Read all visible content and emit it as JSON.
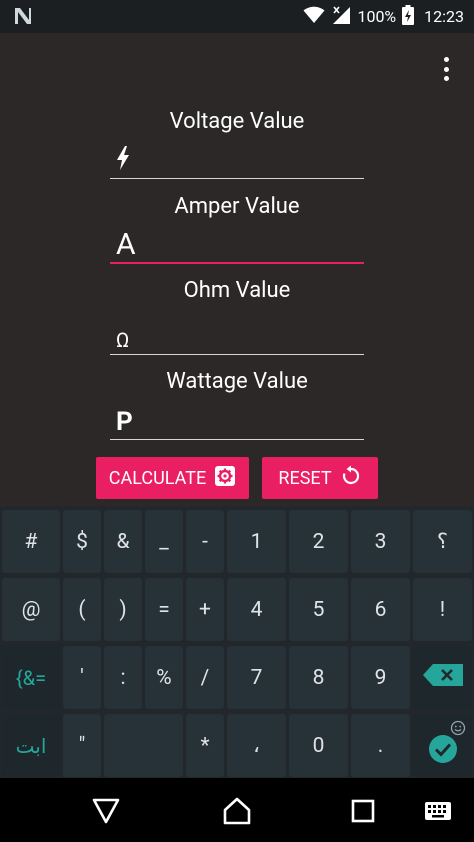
{
  "status_bar": {
    "notification_icon": "n-logo-icon",
    "battery_percent": "100%",
    "time": "12:23"
  },
  "app": {
    "menu_icon": "overflow-menu-icon",
    "fields": [
      {
        "label": "Voltage Value",
        "glyph": "⚡",
        "icon": "lightning-icon"
      },
      {
        "label": "Amper Value",
        "glyph": "A",
        "icon": "ampere-letter-icon"
      },
      {
        "label": "Ohm Value",
        "glyph": "Ω",
        "icon": "omega-icon"
      },
      {
        "label": "Wattage Value",
        "glyph": "P",
        "icon": "power-letter-icon"
      }
    ],
    "buttons": {
      "calculate": "CALCULATE",
      "reset": "RESET"
    }
  },
  "keyboard": {
    "rows": [
      [
        "#",
        "$",
        "&",
        "_",
        "-",
        "1",
        "2",
        "3",
        "؟"
      ],
      [
        "@",
        "(",
        ")",
        "=",
        "+",
        "4",
        "5",
        "6",
        "!"
      ],
      [
        "{&=",
        "'",
        ":",
        "%",
        "/",
        "7",
        "8",
        "9",
        ""
      ],
      [
        "ابت",
        "\"",
        "",
        "*",
        "،",
        "0",
        "."
      ]
    ]
  },
  "colors": {
    "accent": "#e91e63",
    "app_background": "#2b2827",
    "keyboard_background": "#21272b",
    "key_accent": "#26a69a"
  }
}
